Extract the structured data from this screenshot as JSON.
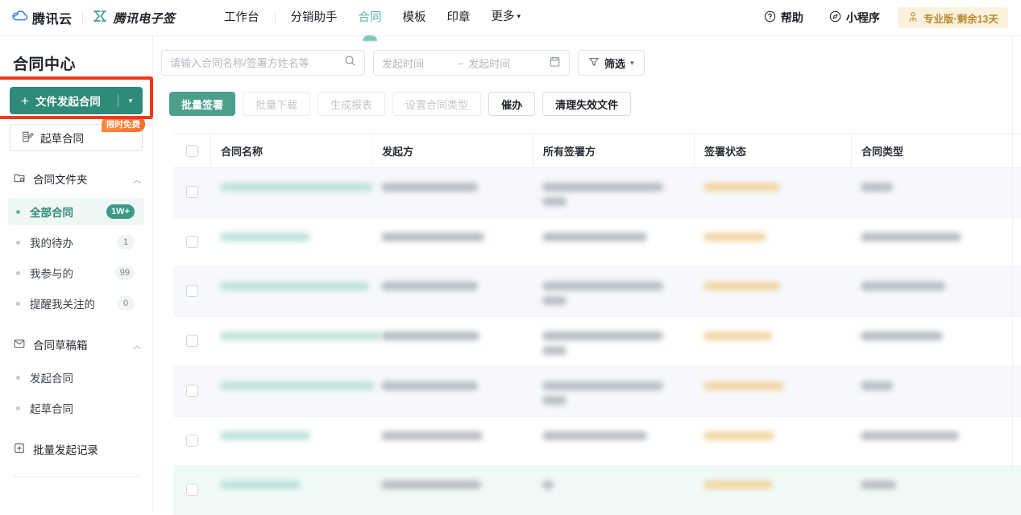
{
  "topbar": {
    "brand_cloud": "腾讯云",
    "brand_esign": "腾讯电子签",
    "nav": [
      {
        "label": "工作台",
        "active": false
      },
      {
        "label": "分销助手",
        "active": false
      },
      {
        "label": "合同",
        "active": true
      },
      {
        "label": "模板",
        "active": false
      },
      {
        "label": "印章",
        "active": false
      },
      {
        "label": "更多",
        "active": false,
        "caret": "▾"
      }
    ],
    "help_label": "帮助",
    "miniapp_label": "小程序",
    "pro_badge": "专业版·剩余13天",
    "pro_badge_color": "#b8892f",
    "pro_badge_bg": "#fbf1dd",
    "accent_color": "#58b6a5"
  },
  "sidebar": {
    "title": "合同中心",
    "primary_button": {
      "plus": "+",
      "label": "文件发起合同",
      "arrow": "▾",
      "color": "#2f8a79"
    },
    "secondary_button": {
      "label": "起草合同",
      "tag": "限时免费",
      "tag_color": "#fb6b2a"
    },
    "highlight_color": "#f03a17",
    "groups": [
      {
        "label": "合同文件夹",
        "icon": "folder-icon",
        "chevron": "︿",
        "items": [
          {
            "label": "全部合同",
            "count": "1W+",
            "active": true
          },
          {
            "label": "我的待办",
            "count": "1",
            "active": false
          },
          {
            "label": "我参与的",
            "count": "99",
            "active": false
          },
          {
            "label": "提醒我关注的",
            "count": "0",
            "active": false
          }
        ]
      },
      {
        "label": "合同草稿箱",
        "icon": "inbox-icon",
        "chevron": "︿",
        "items": [
          {
            "label": "发起合同",
            "count": "",
            "active": false
          },
          {
            "label": "起草合同",
            "count": "",
            "active": false
          }
        ]
      }
    ],
    "bottom_item": {
      "label": "批量发起记录",
      "icon": "batch-icon"
    }
  },
  "filterbar": {
    "search": {
      "value": "",
      "placeholder": "请输入合同名称/签署方姓名等",
      "icon": "search-icon"
    },
    "date": {
      "start_placeholder": "发起时间",
      "end_placeholder": "发起时间",
      "separator": "–",
      "icon": "calendar-icon"
    },
    "filter_button": {
      "label": "筛选",
      "icon": "filter-icon",
      "caret": "▾"
    }
  },
  "actionbar": {
    "buttons": [
      {
        "label": "批量签署",
        "state": "primary"
      },
      {
        "label": "批量下载",
        "state": "disabled"
      },
      {
        "label": "生成报表",
        "state": "disabled"
      },
      {
        "label": "设置合同类型",
        "state": "disabled"
      },
      {
        "label": "催办",
        "state": "normal"
      },
      {
        "label": "清理失效文件",
        "state": "normal"
      }
    ]
  },
  "table": {
    "columns": [
      "合同名称",
      "发起方",
      "所有签署方",
      "签署状态",
      "合同类型"
    ],
    "rows": [
      {
        "style": "alt",
        "name_w": 190,
        "party_w": 120,
        "signers": [
          150,
          30
        ],
        "status_w": 95,
        "type_w": 40
      },
      {
        "style": "plain",
        "name_w": 112,
        "party_w": 128,
        "signers": [
          130
        ],
        "status_w": 78,
        "type_w": 125
      },
      {
        "style": "alt",
        "name_w": 185,
        "party_w": 120,
        "signers": [
          150,
          30
        ],
        "status_w": 95,
        "type_w": 105
      },
      {
        "style": "plain",
        "name_w": 200,
        "party_w": 122,
        "signers": [
          150,
          30
        ],
        "status_w": 85,
        "type_w": 102
      },
      {
        "style": "alt",
        "name_w": 192,
        "party_w": 120,
        "signers": [
          150,
          30
        ],
        "status_w": 100,
        "type_w": 40
      },
      {
        "style": "plain",
        "name_w": 112,
        "party_w": 126,
        "signers": [
          130
        ],
        "status_w": 88,
        "type_w": 122
      },
      {
        "style": "hover",
        "name_w": 100,
        "party_w": 124,
        "signers": [
          14
        ],
        "status_w": 86,
        "type_w": 44
      }
    ]
  }
}
